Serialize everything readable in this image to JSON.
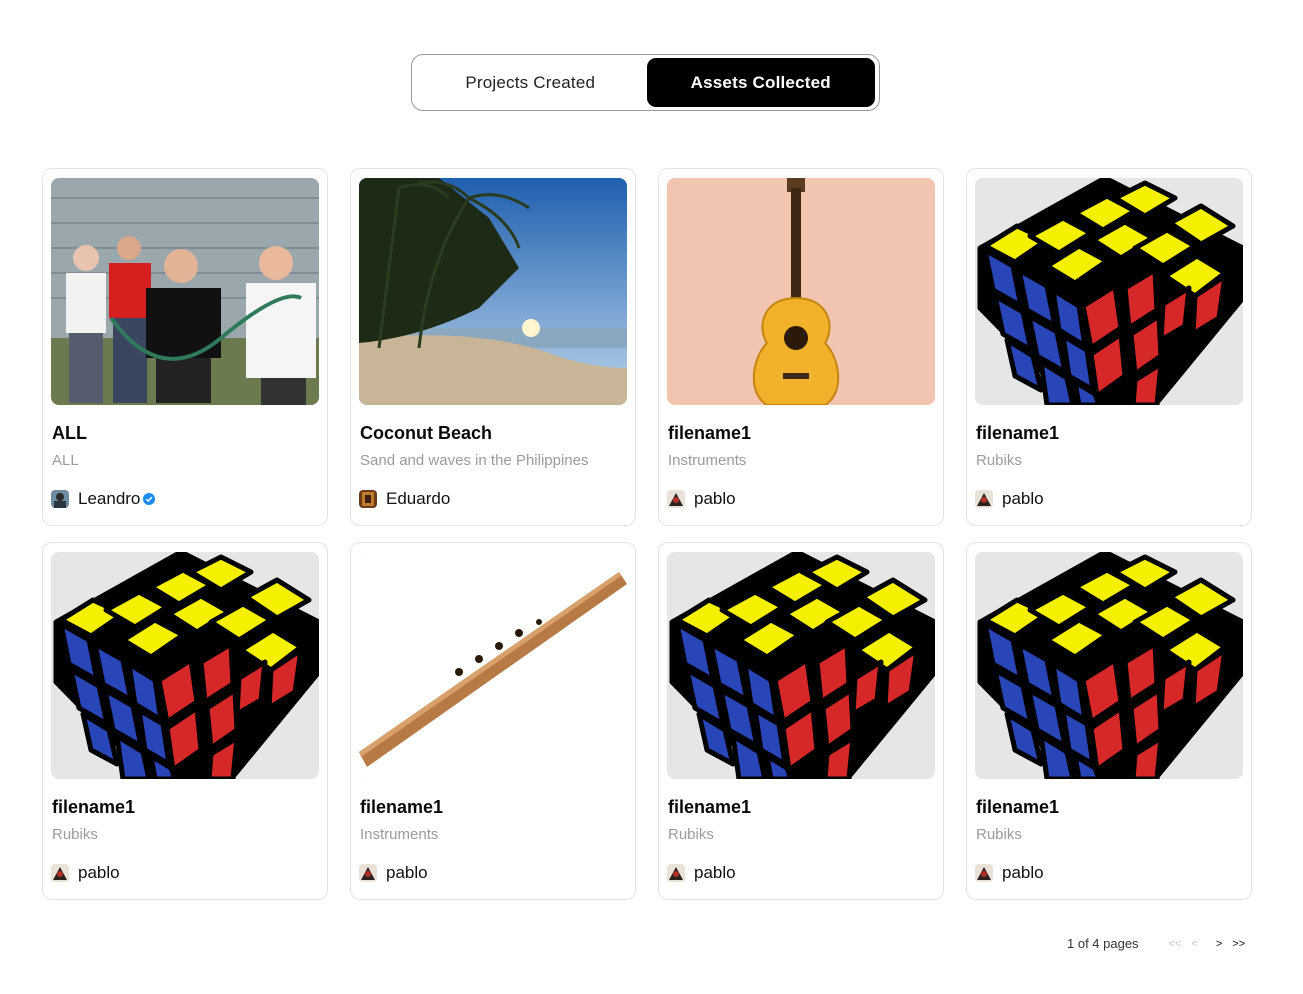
{
  "tabs": {
    "projects_created": "Projects Created",
    "assets_collected": "Assets Collected",
    "active": "assets_collected"
  },
  "cards": [
    {
      "title": "ALL",
      "subtitle": "ALL",
      "author": "Leandro",
      "verified": true,
      "thumb": "band-photo"
    },
    {
      "title": "Coconut Beach",
      "subtitle": "Sand and waves in the Philippines",
      "author": "Eduardo",
      "verified": false,
      "thumb": "beach-photo"
    },
    {
      "title": "filename1",
      "subtitle": "Instruments",
      "author": "pablo",
      "verified": false,
      "thumb": "guitar-photo"
    },
    {
      "title": "filename1",
      "subtitle": "Rubiks",
      "author": "pablo",
      "verified": false,
      "thumb": "rubiks-cube"
    },
    {
      "title": "filename1",
      "subtitle": "Rubiks",
      "author": "pablo",
      "verified": false,
      "thumb": "rubiks-cube"
    },
    {
      "title": "filename1",
      "subtitle": "Instruments",
      "author": "pablo",
      "verified": false,
      "thumb": "flute-photo"
    },
    {
      "title": "filename1",
      "subtitle": "Rubiks",
      "author": "pablo",
      "verified": false,
      "thumb": "rubiks-cube"
    },
    {
      "title": "filename1",
      "subtitle": "Rubiks",
      "author": "pablo",
      "verified": false,
      "thumb": "rubiks-cube"
    }
  ],
  "pagination": {
    "info": "1 of 4 pages",
    "first": "<<",
    "prev": "<",
    "next": ">",
    "last": ">>"
  },
  "colors": {
    "active_tab_bg": "#000000",
    "verified_badge": "#1d8cf0",
    "subtitle_text": "#9b9b9b"
  }
}
